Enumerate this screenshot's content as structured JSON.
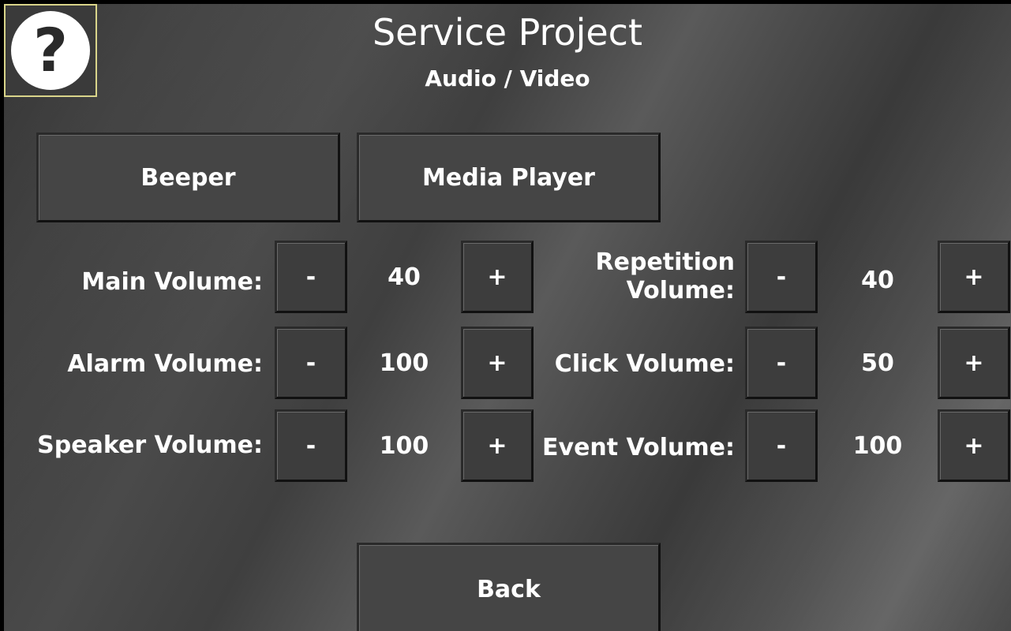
{
  "header": {
    "help_icon_glyph": "?",
    "title": "Service Project",
    "subtitle": "Audio / Video"
  },
  "tabs": {
    "beeper_label": "Beeper",
    "media_player_label": "Media Player"
  },
  "controls": {
    "decrement_label": "-",
    "increment_label": "+",
    "main_volume": {
      "label": "Main Volume:",
      "value": "40"
    },
    "alarm_volume": {
      "label": "Alarm Volume:",
      "value": "100"
    },
    "speaker_volume": {
      "label": "Speaker Volume:",
      "value": "100"
    },
    "repetition_volume": {
      "label_line1": "Repetition",
      "label_line2": "Volume:",
      "value": "40"
    },
    "click_volume": {
      "label": "Click Volume:",
      "value": "50"
    },
    "event_volume": {
      "label": "Event Volume:",
      "value": "100"
    }
  },
  "footer": {
    "back_label": "Back"
  },
  "colors": {
    "help_border": "#d9d48a",
    "button_face": "#454545",
    "text": "#ffffff"
  }
}
